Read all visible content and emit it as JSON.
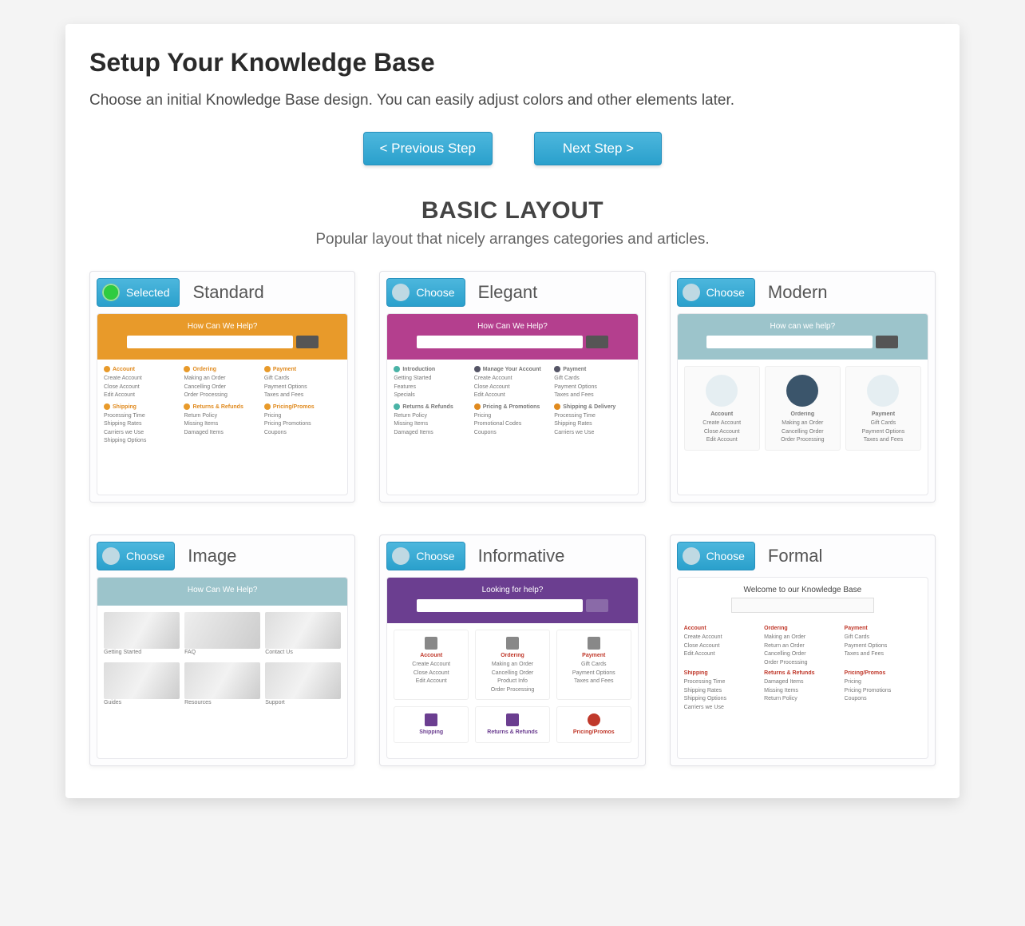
{
  "page": {
    "title": "Setup Your Knowledge Base",
    "subtitle": "Choose an initial Knowledge Base design. You can easily adjust colors and other elements later."
  },
  "nav": {
    "prev": "< Previous Step",
    "next": "Next Step >"
  },
  "section": {
    "title": "BASIC LAYOUT",
    "subtitle": "Popular layout that nicely arranges categories and articles."
  },
  "common": {
    "choose_label": "Choose",
    "selected_label": "Selected"
  },
  "layouts": {
    "standard": {
      "name": "Standard",
      "selected": true,
      "hero_text": "How Can We Help?",
      "hero_color": "#e89a2a",
      "cats": [
        {
          "h": "Account",
          "items": [
            "Create Account",
            "Close Account",
            "Edit Account"
          ]
        },
        {
          "h": "Ordering",
          "items": [
            "Making an Order",
            "Cancelling Order",
            "Order Processing"
          ]
        },
        {
          "h": "Payment",
          "items": [
            "Gift Cards",
            "Payment Options",
            "Taxes and Fees"
          ]
        },
        {
          "h": "Shipping",
          "items": [
            "Processing Time",
            "Shipping Rates",
            "Carriers we Use",
            "Shipping Options"
          ]
        },
        {
          "h": "Returns & Refunds",
          "items": [
            "Return Policy",
            "Missing Items",
            "Damaged Items"
          ]
        },
        {
          "h": "Pricing/Promos",
          "items": [
            "Pricing",
            "Pricing Promotions",
            "Coupons"
          ]
        }
      ]
    },
    "elegant": {
      "name": "Elegant",
      "selected": false,
      "hero_text": "How Can We Help?",
      "hero_color": "#b43f8e",
      "cats": [
        {
          "h": "Introduction",
          "items": [
            "Getting Started",
            "Features",
            "Specials"
          ]
        },
        {
          "h": "Manage Your Account",
          "items": [
            "Create Account",
            "Close Account",
            "Edit Account"
          ]
        },
        {
          "h": "Payment",
          "items": [
            "Gift Cards",
            "Payment Options",
            "Taxes and Fees"
          ]
        },
        {
          "h": "Returns & Refunds",
          "items": [
            "Return Policy",
            "Missing Items",
            "Damaged Items"
          ]
        },
        {
          "h": "Pricing & Promotions",
          "items": [
            "Pricing",
            "Promotional Codes",
            "Coupons"
          ]
        },
        {
          "h": "Shipping & Delivery",
          "items": [
            "Processing Time",
            "Shipping Rates",
            "Carriers we Use"
          ]
        }
      ]
    },
    "modern": {
      "name": "Modern",
      "selected": false,
      "hero_text": "How can we help?",
      "hero_color": "#9cc4cb",
      "tiles": [
        {
          "h": "Account",
          "items": [
            "Create Account",
            "Close Account",
            "Edit Account"
          ]
        },
        {
          "h": "Ordering",
          "items": [
            "Making an Order",
            "Cancelling Order",
            "Order Processing"
          ]
        },
        {
          "h": "Payment",
          "items": [
            "Gift Cards",
            "Payment Options",
            "Taxes and Fees"
          ]
        }
      ]
    },
    "image": {
      "name": "Image",
      "selected": false,
      "hero_text": "How Can We Help?",
      "hero_color": "#9cc4cb",
      "thumbs": [
        {
          "cap": "Getting Started"
        },
        {
          "cap": "FAQ"
        },
        {
          "cap": "Contact Us"
        },
        {
          "cap": "Guides"
        },
        {
          "cap": "Resources"
        },
        {
          "cap": "Support"
        }
      ]
    },
    "informative": {
      "name": "Informative",
      "selected": false,
      "hero_text": "Looking for help?",
      "hero_color": "#6b3e90",
      "row1": [
        {
          "h": "Account",
          "items": [
            "Create Account",
            "Close Account",
            "Edit Account"
          ]
        },
        {
          "h": "Ordering",
          "items": [
            "Making an Order",
            "Cancelling Order",
            "Product Info",
            "Order Processing"
          ]
        },
        {
          "h": "Payment",
          "items": [
            "Gift Cards",
            "Payment Options",
            "Taxes and Fees"
          ]
        }
      ],
      "row2": [
        {
          "h": "Shipping"
        },
        {
          "h": "Returns & Refunds"
        },
        {
          "h": "Pricing/Promos"
        }
      ]
    },
    "formal": {
      "name": "Formal",
      "selected": false,
      "hero_text": "Welcome to our Knowledge Base",
      "cats": [
        {
          "h": "Account",
          "items": [
            "Create Account",
            "Close Account",
            "Edit Account"
          ]
        },
        {
          "h": "Ordering",
          "items": [
            "Making an Order",
            "Return an Order",
            "Cancelling Order",
            "Order Processing"
          ]
        },
        {
          "h": "Payment",
          "items": [
            "Gift Cards",
            "Payment Options",
            "Taxes and Fees"
          ]
        },
        {
          "h": "Shipping",
          "items": [
            "Processing Time",
            "Shipping Rates",
            "Shipping Options",
            "Carriers we Use"
          ]
        },
        {
          "h": "Returns & Refunds",
          "items": [
            "Damaged Items",
            "Missing Items",
            "Return Policy"
          ]
        },
        {
          "h": "Pricing/Promos",
          "items": [
            "Pricing",
            "Pricing Promotions",
            "Coupons"
          ]
        }
      ]
    }
  }
}
